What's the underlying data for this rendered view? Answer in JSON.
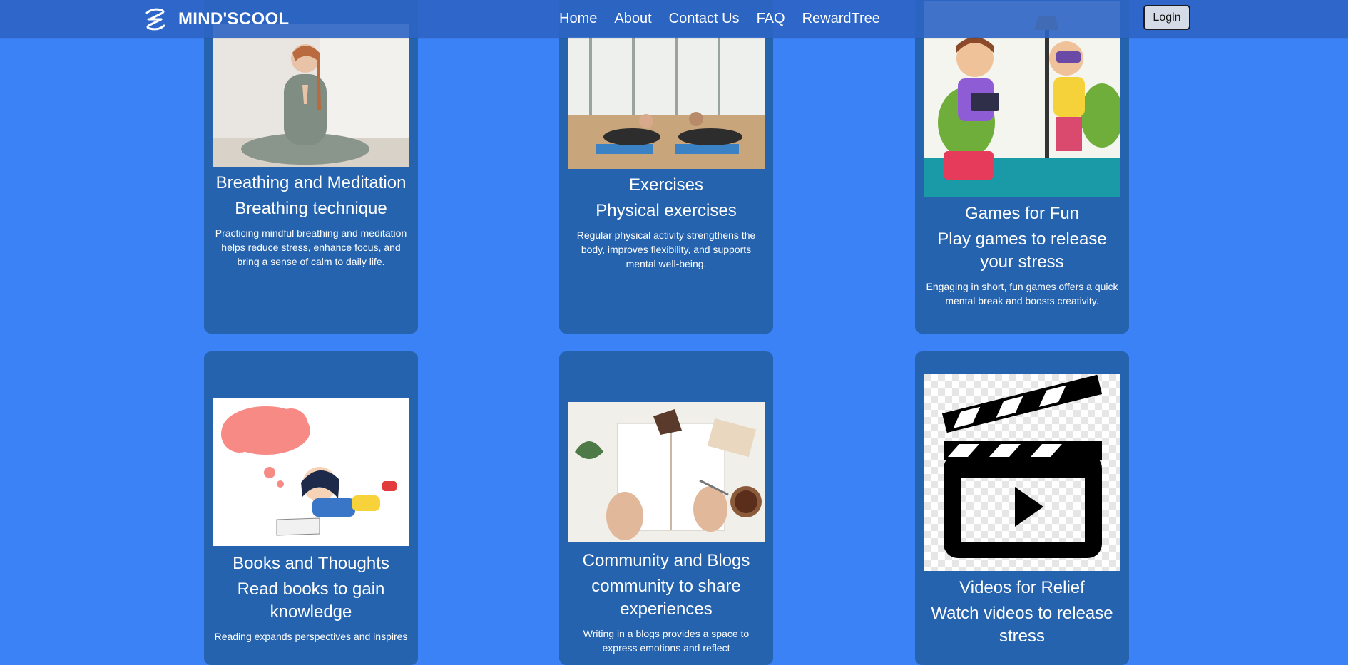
{
  "navbar": {
    "brand": "MIND'SCOOL",
    "links": [
      "Home",
      "About",
      "Contact Us",
      "FAQ",
      "RewardTree"
    ],
    "login": "Login"
  },
  "cards": [
    {
      "title": "Breathing and Meditation",
      "subtitle": "Breathing technique",
      "desc": "Practicing mindful breathing and meditation helps reduce stress, enhance focus, and bring a sense of calm to daily life."
    },
    {
      "title": "Exercises",
      "subtitle": "Physical exercises",
      "desc": "Regular physical activity strengthens the body, improves flexibility, and supports mental well-being."
    },
    {
      "title": "Games for Fun",
      "subtitle": "Play games to release your stress",
      "desc": "Engaging in short, fun games offers a quick mental break and boosts creativity."
    },
    {
      "title": "Books and Thoughts",
      "subtitle": "Read books to gain knowledge",
      "desc": "Reading expands perspectives and inspires"
    },
    {
      "title": "Community and Blogs",
      "subtitle": "community to share experiences",
      "desc": "Writing in a blogs provides a space to express emotions and reflect"
    },
    {
      "title": "Videos for Relief",
      "subtitle": "Watch videos to release stress",
      "desc": ""
    }
  ],
  "images": {
    "card0": "meditation-photo",
    "card1": "stretching-photo",
    "card2": "kids-gaming-illustration",
    "card3": "girl-reading-illustration",
    "card4": "journal-writing-photo",
    "card5": "clapperboard-icon"
  }
}
